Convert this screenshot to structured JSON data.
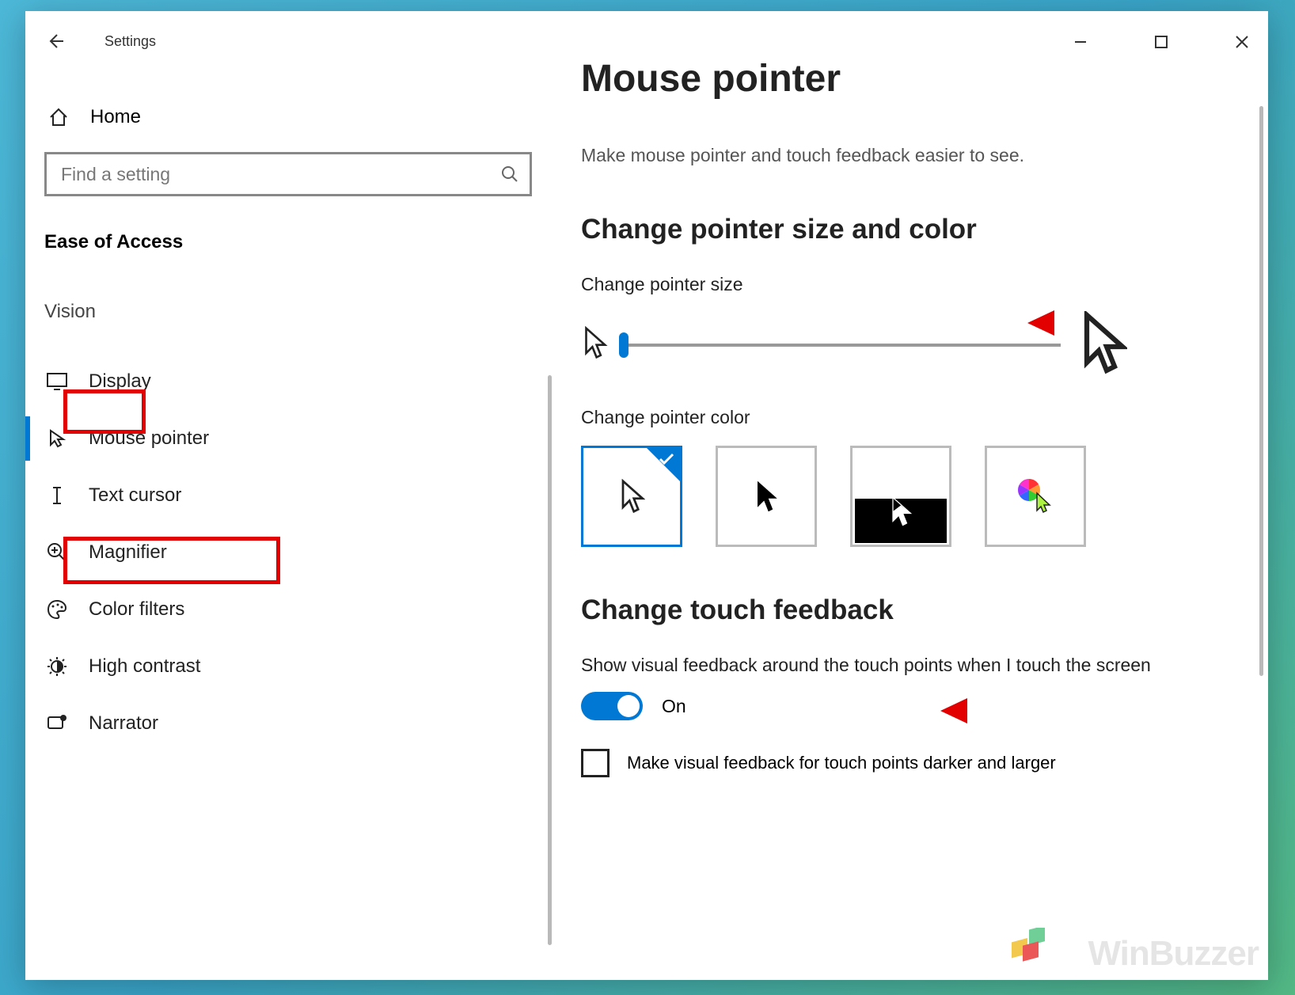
{
  "app": {
    "title": "Settings"
  },
  "sidebar": {
    "home_label": "Home",
    "search_placeholder": "Find a setting",
    "section": "Ease of Access",
    "subsection": "Vision",
    "items": [
      {
        "label": "Display"
      },
      {
        "label": "Mouse pointer"
      },
      {
        "label": "Text cursor"
      },
      {
        "label": "Magnifier"
      },
      {
        "label": "Color filters"
      },
      {
        "label": "High contrast"
      },
      {
        "label": "Narrator"
      }
    ]
  },
  "main": {
    "title": "Mouse pointer",
    "subtitle": "Make mouse pointer and touch feedback easier to see.",
    "section1": "Change pointer size and color",
    "size_label": "Change pointer size",
    "slider_value": 1,
    "color_label": "Change pointer color",
    "section2": "Change touch feedback",
    "touch_desc": "Show visual feedback around the touch points when I touch the screen",
    "toggle_label": "On",
    "checkbox_label": "Make visual feedback for touch points darker and larger"
  },
  "watermark": "WinBuzzer"
}
